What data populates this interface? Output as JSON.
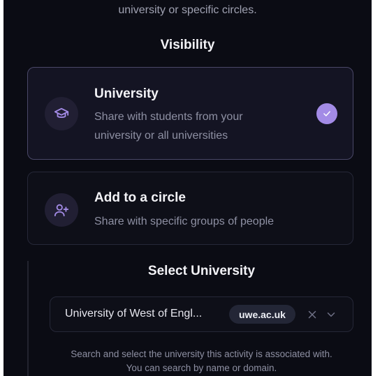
{
  "intro": {
    "text": "university or specific circles."
  },
  "visibility": {
    "heading": "Visibility",
    "options": [
      {
        "title": "University",
        "description": "Share with students from your university or all universities",
        "icon": "graduation-cap-icon",
        "selected": true
      },
      {
        "title": "Add to a circle",
        "description": "Share with specific groups of people",
        "icon": "user-plus-icon",
        "selected": false
      }
    ]
  },
  "university_select": {
    "heading": "Select University",
    "value": "University of West of Engl...",
    "domain": "uwe.ac.uk",
    "help_line1": "Search and select the university this activity is associated with.",
    "help_line2": "You can search by name or domain."
  },
  "colors": {
    "background": "#0b0c14",
    "card": "#0e0f18",
    "selected_card": "#141423",
    "accent": "#a38be6",
    "icon_bg": "#211f33",
    "text": "#f2f2f6",
    "muted": "#8e90a3"
  }
}
